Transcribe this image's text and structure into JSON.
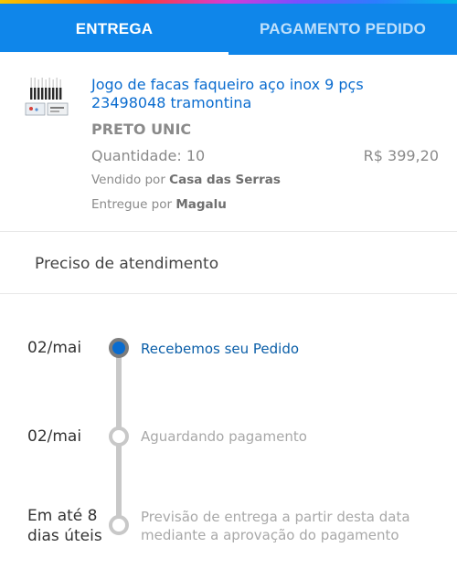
{
  "tabs": [
    {
      "label": "ENTREGA"
    },
    {
      "label": "PAGAMENTO PEDIDO"
    }
  ],
  "product": {
    "title": "Jogo de facas faqueiro aço inox 9 pçs 23498048 tramontina",
    "variant": "PRETO UNIC",
    "quantity": "Quantidade: 10",
    "price": "R$ 399,20",
    "seller_prefix": "Vendido por",
    "seller": "Casa das Serras",
    "shipper_prefix": "Entregue por",
    "shipper": "Magalu"
  },
  "help": {
    "label": "Preciso de atendimento"
  },
  "timeline": [
    {
      "date": "02/mai",
      "label": "Recebemos seu Pedido",
      "status": "done"
    },
    {
      "date": "02/mai",
      "label": "Aguardando pagamento",
      "status": "pending"
    },
    {
      "date_line1": "Em até 8",
      "date_line2": "dias úteis",
      "label_line1": "Previsão de entrega a partir desta data",
      "label_line2": "mediante a aprovação do pagamento",
      "status": "pending"
    }
  ],
  "colors": {
    "tabbar": "#0f86ea",
    "link_blue": "#0a6ccf",
    "muted": "#8a8a8a"
  }
}
